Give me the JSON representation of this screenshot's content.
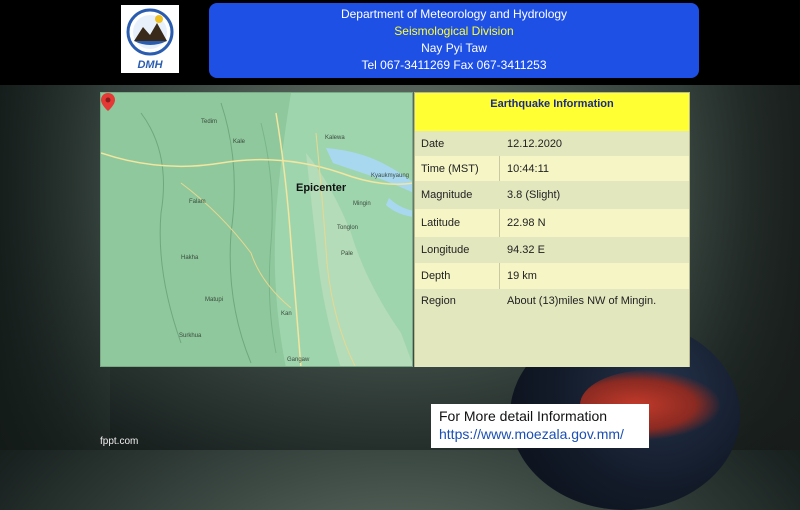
{
  "header": {
    "line1": "Department of Meteorology and Hydrology",
    "line2": "Seismological Division",
    "line3": "Nay Pyi Taw",
    "line4": "Tel 067-3411269 Fax 067-3411253",
    "logo_text": "DMH"
  },
  "map": {
    "epicenter_label": "Epicenter",
    "places": [
      "Tedim",
      "Kale",
      "Kalewa",
      "Falam",
      "Hakha",
      "Gangaw",
      "Mingin",
      "Kyaukmyaung",
      "Pale",
      "Tonglon",
      "Matupi",
      "Surkhua",
      "Kan"
    ]
  },
  "info": {
    "title": "Earthquake  Information",
    "rows": [
      {
        "label": "Date",
        "value": "12.12.2020"
      },
      {
        "label": "Time (MST)",
        "value": "10:44:11"
      },
      {
        "label": "Magnitude",
        "value": "3.8 (Slight)"
      },
      {
        "label": "Latitude",
        "value": "22.98  N"
      },
      {
        "label": "Longitude",
        "value": "94.32  E"
      },
      {
        "label": "Depth",
        "value": "19 km"
      },
      {
        "label": "Region",
        "value": "About (13)miles NW of Mingin."
      }
    ]
  },
  "detail": {
    "line1": "For More detail Information",
    "line2": "https://www.moezala.gov.mm/"
  },
  "footer": "fppt.com",
  "colors": {
    "header_panel": "#1e50e6",
    "division_text": "#ffff33",
    "info_title_bg": "#ffff33",
    "info_bg": "#f5f5c6",
    "map_land": "#9fd5ad",
    "river": "#a8d8f0",
    "pin": "#e53935"
  }
}
